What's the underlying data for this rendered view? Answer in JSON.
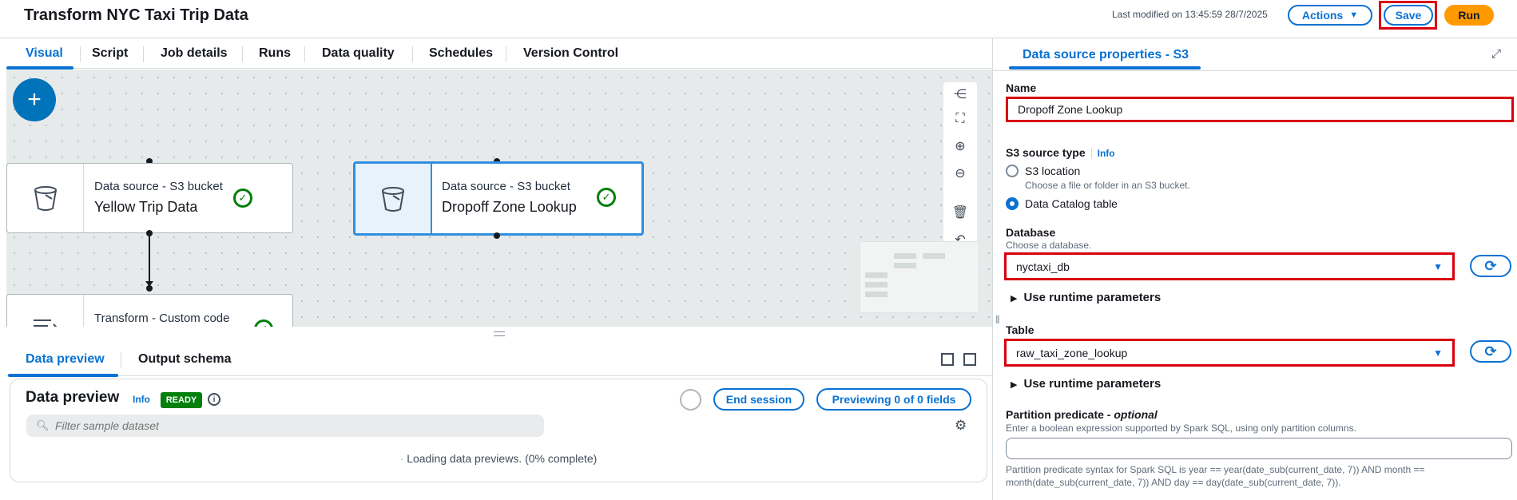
{
  "header": {
    "title": "Transform NYC Taxi Trip Data",
    "last_modified": "Last modified on 13:45:59 28/7/2025",
    "actions_label": "Actions",
    "save_label": "Save",
    "run_label": "Run"
  },
  "tabs": [
    "Visual",
    "Script",
    "Job details",
    "Runs",
    "Data quality",
    "Schedules",
    "Version Control"
  ],
  "canvas": {
    "add_label": "+",
    "nodes": [
      {
        "type": "Data source - S3 bucket",
        "name": "Yellow Trip Data"
      },
      {
        "type": "Data source - S3 bucket",
        "name": "Dropoff Zone Lookup"
      },
      {
        "type": "Transform - Custom code",
        "name": ""
      }
    ]
  },
  "bottom": {
    "tabs": [
      "Data preview",
      "Output schema"
    ],
    "preview_title": "Data preview",
    "info": "Info",
    "status": "READY",
    "end_session": "End session",
    "previewing": "Previewing 0 of 0 fields",
    "filter_placeholder": "Filter sample dataset",
    "loading": "Loading data previews. (0% complete)"
  },
  "panel": {
    "tab": "Data source properties - S3",
    "name_label": "Name",
    "name_value": "Dropoff Zone Lookup",
    "source_type_label": "S3 source type",
    "info": "Info",
    "options": [
      {
        "label": "S3 location",
        "desc": "Choose a file or folder in an S3 bucket.",
        "selected": false
      },
      {
        "label": "Data Catalog table",
        "desc": "",
        "selected": true
      }
    ],
    "database_label": "Database",
    "database_desc": "Choose a database.",
    "database_value": "nyctaxi_db",
    "runtime_label": "Use runtime parameters",
    "table_label": "Table",
    "table_value": "raw_taxi_zone_lookup",
    "partition_label": "Partition predicate - ",
    "partition_optional": "optional",
    "partition_desc": "Enter a boolean expression supported by Spark SQL, using only partition columns.",
    "partition_value": "",
    "partition_syntax": "Partition predicate syntax for Spark SQL is year == year(date_sub(current_date, 7)) AND month == month(date_sub(current_date, 7)) AND day == day(date_sub(current_date, 7))."
  },
  "colors": {
    "accent": "#0972d3",
    "run": "#ff9900",
    "ready": "#037f0c",
    "highlight": "#d8000c"
  }
}
